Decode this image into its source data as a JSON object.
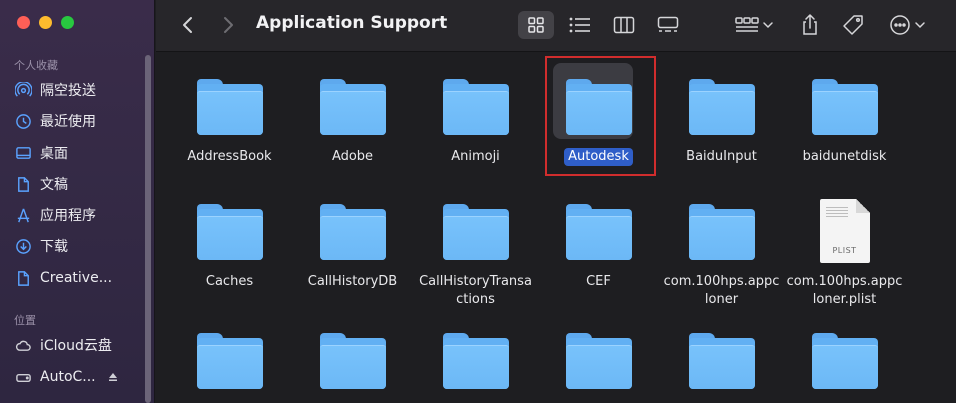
{
  "window": {
    "title": "Application Support"
  },
  "sidebar": {
    "favorites_header": "个人收藏",
    "favorites": [
      {
        "label": "隔空投送",
        "icon": "airdrop-icon"
      },
      {
        "label": "最近使用",
        "icon": "clock-icon"
      },
      {
        "label": "桌面",
        "icon": "desktop-icon"
      },
      {
        "label": "文稿",
        "icon": "document-icon"
      },
      {
        "label": "应用程序",
        "icon": "applications-icon"
      },
      {
        "label": "下载",
        "icon": "download-icon"
      },
      {
        "label": "Creative...",
        "icon": "file-icon"
      }
    ],
    "locations_header": "位置",
    "locations": [
      {
        "label": "iCloud云盘",
        "icon": "cloud-icon"
      },
      {
        "label": "AutoC...",
        "icon": "disk-icon"
      }
    ]
  },
  "toolbar": {
    "back_icon": "chevron-left-icon",
    "forward_icon": "chevron-right-icon",
    "views": [
      "grid-view-icon",
      "list-view-icon",
      "column-view-icon",
      "gallery-view-icon"
    ],
    "group_icon": "group-by-icon",
    "share_icon": "share-icon",
    "tag_icon": "tag-icon",
    "more_icon": "more-icon"
  },
  "files": [
    {
      "name": "AddressBook",
      "type": "folder"
    },
    {
      "name": "Adobe",
      "type": "folder"
    },
    {
      "name": "Animoji",
      "type": "folder"
    },
    {
      "name": "Autodesk",
      "type": "folder",
      "selected": true
    },
    {
      "name": "BaiduInput",
      "type": "folder"
    },
    {
      "name": "baidunetdisk",
      "type": "folder"
    },
    {
      "name": "Caches",
      "type": "folder"
    },
    {
      "name": "CallHistoryDB",
      "type": "folder"
    },
    {
      "name": "CallHistoryTransa\nctions",
      "type": "folder"
    },
    {
      "name": "CEF",
      "type": "folder"
    },
    {
      "name": "com.100hps.appc\nloner",
      "type": "folder"
    },
    {
      "name": "com.100hps.appc\nloner.plist",
      "type": "plist",
      "badge": "PLIST"
    },
    {
      "name": "",
      "type": "folder"
    },
    {
      "name": "",
      "type": "folder"
    },
    {
      "name": "",
      "type": "folder"
    },
    {
      "name": "",
      "type": "folder"
    },
    {
      "name": "",
      "type": "folder"
    },
    {
      "name": "",
      "type": "folder"
    }
  ],
  "colors": {
    "selection": "#2f5ec8",
    "highlight_box": "#d12d2d",
    "folder": "#6cb8f6",
    "sidebar_icon": "#5aa2ff"
  }
}
